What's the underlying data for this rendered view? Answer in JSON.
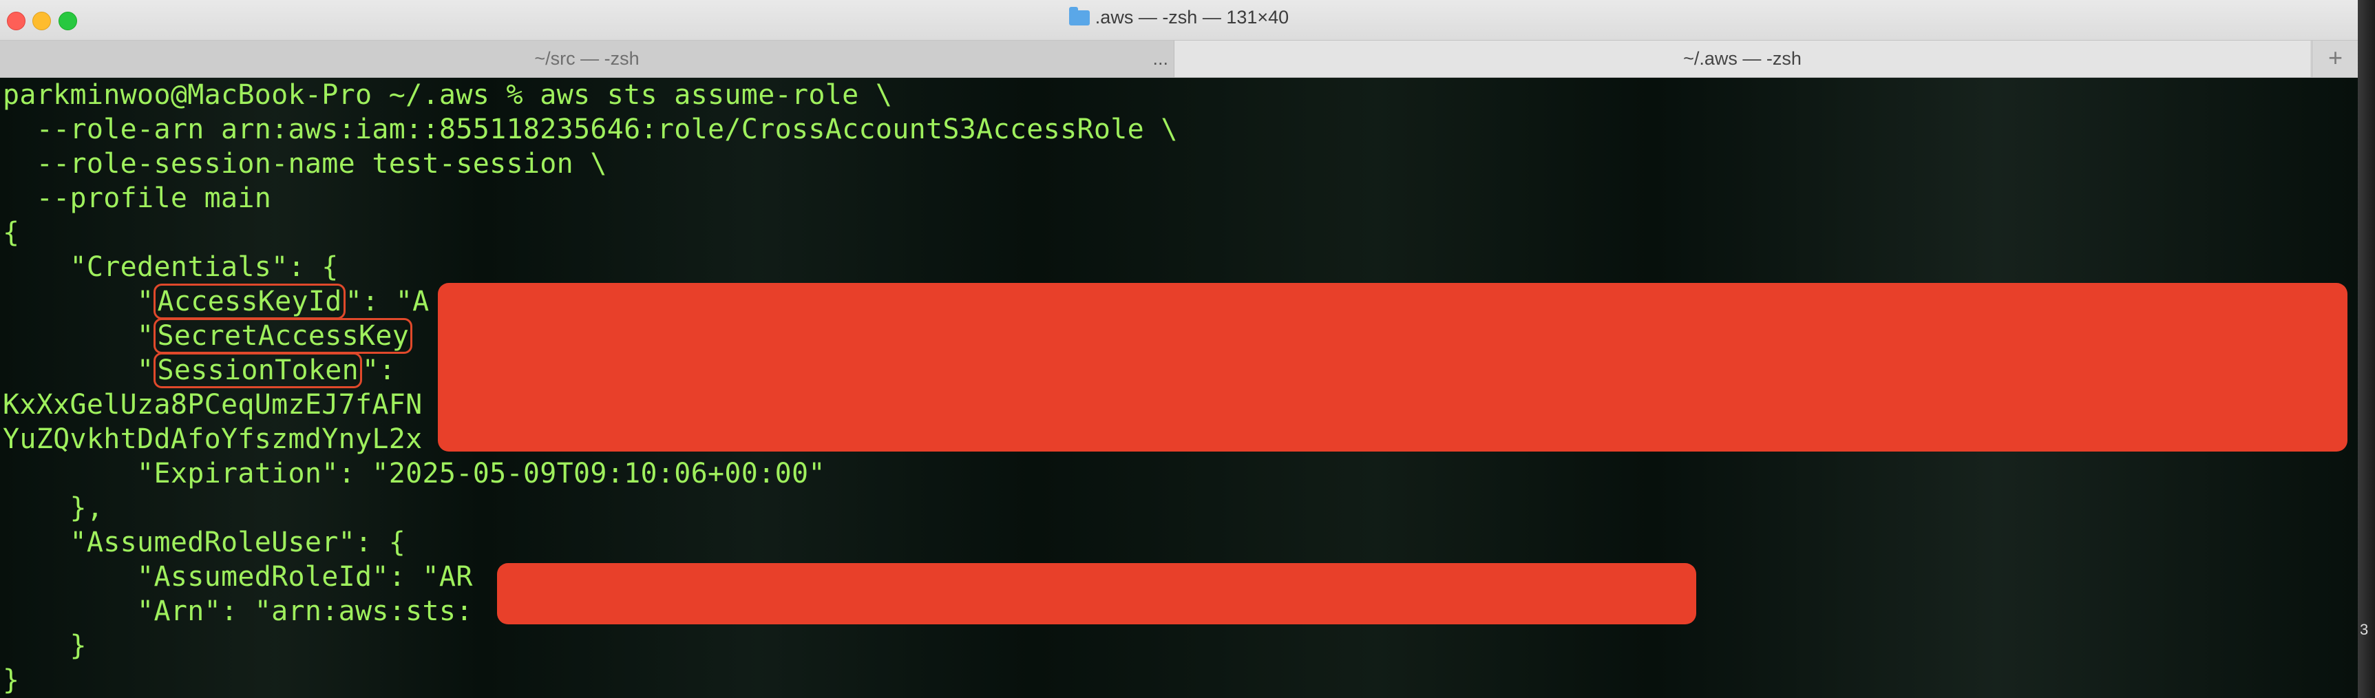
{
  "window": {
    "title": ".aws — -zsh — 131×40"
  },
  "tabs": [
    {
      "label": "~/src — -zsh",
      "more": "..."
    },
    {
      "label": "~/.aws — -zsh"
    }
  ],
  "new_tab_label": "+",
  "terminal": {
    "lines": [
      "parkminwoo@MacBook-Pro ~/.aws % aws sts assume-role \\",
      "  --role-arn arn:aws:iam::855118235646:role/CrossAccountS3AccessRole \\",
      "  --role-session-name test-session \\",
      "  --profile main",
      "{",
      "    \"Credentials\": {",
      "        \"",
      "        \"",
      "        \"",
      "KxXxGelUza8PCeqUmzEJ7fAFN",
      "YuZQvkhtDdAfoYfszmdYnyL2x",
      "        \"Expiration\": \"2025-05-09T09:10:06+00:00\"",
      "    },",
      "    \"AssumedRoleUser\": {",
      "        \"AssumedRoleId\": \"AR",
      "        \"Arn\": \"arn:aws:sts:",
      "    }",
      "}"
    ],
    "highlighted_keys": {
      "access_key": "AccessKeyId",
      "access_key_tail": "\": \"A",
      "secret_key": "SecretAccessKey",
      "session_token": "SessionToken",
      "session_token_tail": "\": "
    }
  },
  "edge_number": "3",
  "colors": {
    "terminal_text": "#9ff05d",
    "redaction": "#e8402a",
    "highlight_border": "#e0492b"
  }
}
